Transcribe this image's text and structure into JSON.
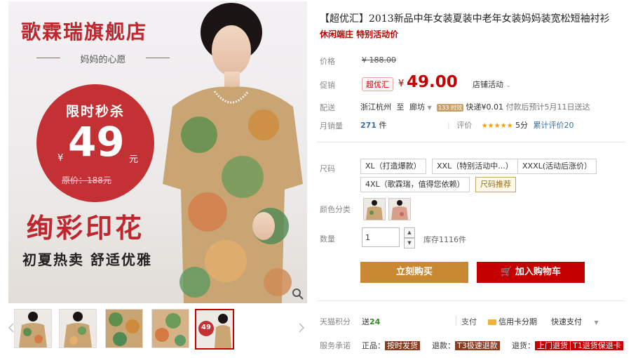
{
  "left": {
    "brand": "歌霖瑞旗舰店",
    "slogan": "妈妈的心愿",
    "badge_title": "限时秒杀",
    "badge_yen": "¥",
    "badge_price": "49",
    "badge_unit": "元",
    "badge_orig": "原价：188元",
    "art_title": "绚彩印花",
    "art_sub": "初夏热卖   舒适优雅",
    "thumbnails": [
      {
        "name": "thumb-1"
      },
      {
        "name": "thumb-2"
      },
      {
        "name": "thumb-3"
      },
      {
        "name": "thumb-4"
      },
      {
        "name": "thumb-5",
        "badge": "49"
      }
    ]
  },
  "product": {
    "title": "【超优汇】2013新品中年女装夏装中老年女装妈妈装宽松短袖衬衫",
    "subtitle": "休闲端庄 特别活动价",
    "price_label": "价格",
    "orig_price": "¥ 188.00",
    "promo_label": "促销",
    "promo_tag": "超优汇",
    "promo_yen": "¥",
    "promo_price": "49.00",
    "shop_activity": "店铺活动",
    "shipping_label": "配送",
    "ship_from": "浙江杭州",
    "ship_to_word": "至",
    "ship_to": "廊坊",
    "ship_mini": "133 时效",
    "ship_fee": "快递¥0.01",
    "ship_note": "付款后预计5月11日送达",
    "sales_label": "月销量",
    "sales_count": "271",
    "sales_unit": "件",
    "rating_label": "评价",
    "stars": "★★★★★",
    "rating_score": "5分",
    "review_count": "累计评价20",
    "size_label": "尺码",
    "sizes": [
      "XL（打造爆款）",
      "XXL（特别活动中...）",
      "XXXL(活动后涨价）",
      "4XL（歌霖瑞，值得您依赖）"
    ],
    "size_recommend": "尺码推荐",
    "color_label": "颜色分类",
    "qty_label": "数量",
    "qty_value": "1",
    "stock": "库存1116件",
    "buy_now": "立刻购买",
    "add_cart": "加入购物车",
    "points_label": "天猫积分",
    "points_prefix": "送",
    "points_value": "24",
    "pay_label": "支付",
    "pay_credit": "信用卡分期",
    "pay_quick": "快速支付",
    "service_label": "服务承诺",
    "services": [
      {
        "label": "正品：",
        "chip": "按时发货"
      },
      {
        "label": "退款：",
        "chip": "T3极速退款"
      },
      {
        "label": "退货：",
        "chip": "上门退货"
      },
      {
        "label": "",
        "chip": "T1退货保退卡"
      }
    ]
  },
  "colors": {
    "accent_red": "#c40000",
    "buy_orange": "#c98832",
    "badge_red": "#c43135"
  }
}
